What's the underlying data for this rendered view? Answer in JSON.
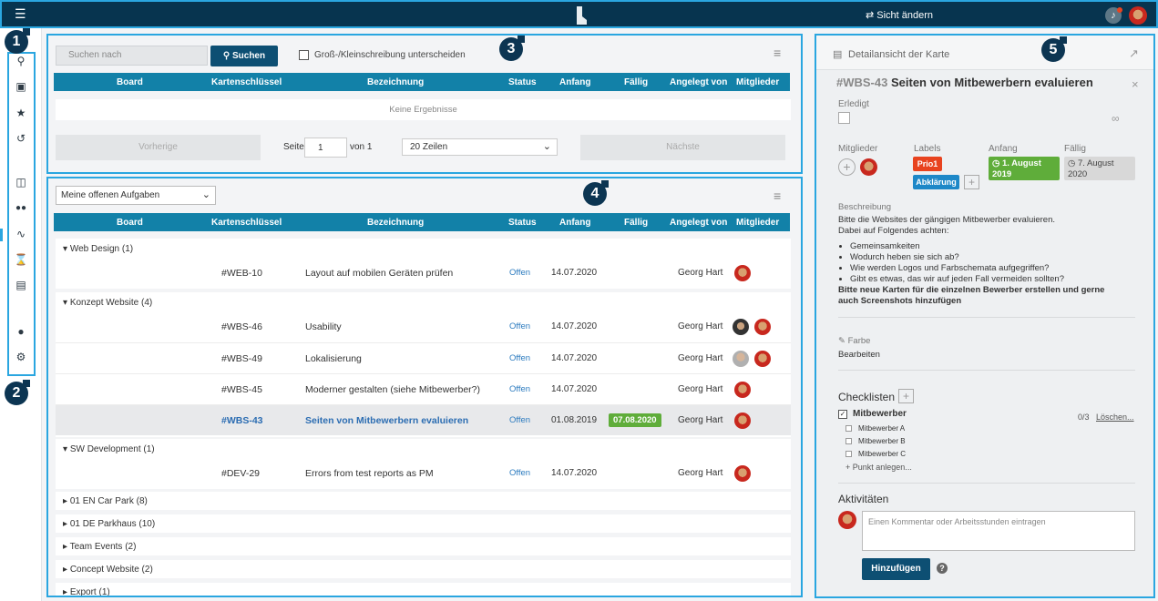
{
  "topbar": {
    "menu_icon": "hamburger-icon",
    "view_label": "⇄ Sicht ändern",
    "bell_icon": "bell-icon"
  },
  "callouts": [
    "1",
    "2",
    "3",
    "4",
    "5"
  ],
  "sidebar": {
    "items": [
      {
        "icon": "search-icon",
        "glyph": "⌕"
      },
      {
        "icon": "add-card-icon",
        "glyph": "▣"
      },
      {
        "icon": "star-icon",
        "glyph": "★"
      },
      {
        "icon": "history-icon",
        "glyph": "↺"
      },
      {
        "icon": "board-icon",
        "glyph": "▥"
      },
      {
        "icon": "team-icon",
        "glyph": "👥"
      },
      {
        "icon": "activity-icon",
        "glyph": "∿"
      },
      {
        "icon": "hourglass-icon",
        "glyph": "⧗"
      },
      {
        "icon": "archive-icon",
        "glyph": "▤"
      },
      {
        "icon": "user-icon",
        "glyph": "●"
      },
      {
        "icon": "settings-icon",
        "glyph": "⚙"
      }
    ]
  },
  "search": {
    "placeholder": "Suchen nach",
    "button": "Suchen",
    "case_label": "Groß-/Kleinschreibung unterscheiden",
    "columns": [
      "Board",
      "Kartenschlüssel",
      "Bezeichnung",
      "Status",
      "Anfang",
      "Fällig",
      "Angelegt von",
      "Mitglieder"
    ],
    "empty": "Keine Ergebnisse",
    "prev": "Vorherige",
    "page_label": "Seite",
    "page_value": "1",
    "of_label": "von 1",
    "rows_option": "20 Zeilen",
    "next": "Nächste"
  },
  "tasks": {
    "filter": "Meine offenen Aufgaben",
    "columns": [
      "Board",
      "Kartenschlüssel",
      "Bezeichnung",
      "Status",
      "Anfang",
      "Fällig",
      "Angelegt von",
      "Mitglieder"
    ],
    "groups": [
      {
        "title": "Web Design (1)",
        "rows": [
          {
            "key": "#WEB-10",
            "title": "Layout auf mobilen Geräten prüfen",
            "status": "Offen",
            "start": "14.07.2020",
            "due": "",
            "creator": "Georg Hart"
          }
        ]
      },
      {
        "title": "Konzept Website (4)",
        "rows": [
          {
            "key": "#WBS-46",
            "title": "Usability",
            "status": "Offen",
            "start": "14.07.2020",
            "due": "",
            "creator": "Georg Hart"
          },
          {
            "key": "#WBS-49",
            "title": "Lokalisierung",
            "status": "Offen",
            "start": "14.07.2020",
            "due": "",
            "creator": "Georg Hart"
          },
          {
            "key": "#WBS-45",
            "title": "Moderner gestalten (siehe Mitbewerber?)",
            "status": "Offen",
            "start": "14.07.2020",
            "due": "",
            "creator": "Georg Hart"
          },
          {
            "key": "#WBS-43",
            "title": "Seiten von Mitbewerbern evaluieren",
            "status": "Offen",
            "start": "01.08.2019",
            "due": "07.08.2020",
            "creator": "Georg Hart"
          }
        ]
      },
      {
        "title": "SW Development (1)",
        "rows": [
          {
            "key": "#DEV-29",
            "title": "Errors from test reports as PM",
            "status": "Offen",
            "start": "14.07.2020",
            "due": "",
            "creator": "Georg Hart"
          }
        ]
      }
    ],
    "collapsed": [
      "01 EN Car Park (8)",
      "01 DE Parkhaus (10)",
      "Team Events (2)",
      "Concept Website (2)",
      "Export (1)"
    ]
  },
  "detail": {
    "header": "Detailansicht der Karte",
    "key": "#WBS-43",
    "title": "Seiten von Mitbewerbern evaluieren",
    "done_label": "Erledigt",
    "members_label": "Mitglieder",
    "labels_label": "Labels",
    "start_label": "Anfang",
    "due_label": "Fällig",
    "label_prio": "Prio1",
    "label_clarify": "Abklärung",
    "start_value": "1. August 2019",
    "due_value": "7. August 2020",
    "description_label": "Beschreibung",
    "description_intro": "Bitte die Websites der gängigen Mitbewerber evaluieren.",
    "description_intro2": "Dabei auf Folgendes achten:",
    "bullets": [
      "Gemeinsamkeiten",
      "Wodurch heben sie sich ab?",
      "Wie werden Logos und Farbschemata aufgegriffen?",
      "Gibt es etwas, das wir auf jeden Fall vermeiden sollten?"
    ],
    "bold_note": "Bitte neue Karten für die einzelnen Bewerber erstellen und gerne auch Screenshots hinzufügen",
    "color_label": "Farbe",
    "edit_label": "Bearbeiten",
    "checklists_label": "Checklisten",
    "checklist_title": "Mitbewerber",
    "checklist_count": "0/3",
    "checklist_delete": "Löschen...",
    "checklist_items": [
      "Mitbewerber A",
      "Mitbewerber B",
      "Mitbewerber C"
    ],
    "add_item": "Punkt anlegen...",
    "activities_label": "Aktivitäten",
    "comment_placeholder": "Einen Kommentar oder Arbeitsstunden eintragen",
    "add_button": "Hinzufügen",
    "colors": {
      "prio": "#e8431f",
      "clarify": "#1e88c8",
      "start": "#5fad3a",
      "due": "#d8d8d8"
    }
  }
}
